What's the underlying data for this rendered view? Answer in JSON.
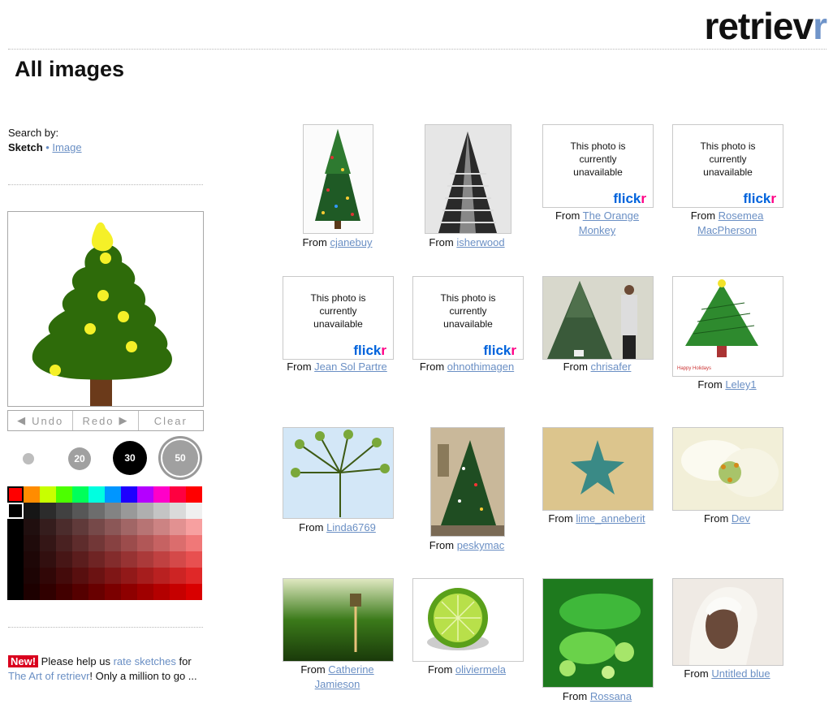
{
  "logo": {
    "part1": "retriev",
    "part2": "r"
  },
  "page_title": "All images",
  "search": {
    "label": "Search by:",
    "sketch": "Sketch",
    "sep": " • ",
    "image": "Image"
  },
  "controls": {
    "undo": "Undo",
    "redo": "Redo",
    "clear": "Clear"
  },
  "brushes": [
    "",
    "20",
    "30",
    "50"
  ],
  "unavailable_text": [
    "This photo is",
    "currently",
    "unavailable"
  ],
  "flickr": {
    "a": "flick",
    "b": "r"
  },
  "results": [
    {
      "from": "From",
      "user": "cjanebuy"
    },
    {
      "from": "From",
      "user": "isherwood"
    },
    {
      "from": "From",
      "user": "The Orange Monkey"
    },
    {
      "from": "From",
      "user": "Rosemea MacPherson"
    },
    {
      "from": "From",
      "user": "Jean Sol Partre"
    },
    {
      "from": "From",
      "user": "ohnothimagen"
    },
    {
      "from": "From",
      "user": "chrisafer"
    },
    {
      "from": "From",
      "user": "Leley1"
    },
    {
      "from": "From",
      "user": "Linda6769"
    },
    {
      "from": "From",
      "user": "peskymac"
    },
    {
      "from": "From",
      "user": "lime_anneberit"
    },
    {
      "from": "From",
      "user": "Dev"
    },
    {
      "from": "From",
      "user": "Catherine Jamieson"
    },
    {
      "from": "From",
      "user": "oliviermela"
    },
    {
      "from": "From",
      "user": "Rossana"
    },
    {
      "from": "From",
      "user": "Untitled blue"
    }
  ],
  "news": {
    "badge": "New!",
    "t1": " Please help us ",
    "link1": "rate sketches",
    "t2": " for ",
    "link2": "The Art of retrievr",
    "t3": "! Only a million to go ..."
  },
  "colors": {
    "accent": "#6a8fc4",
    "new_badge": "#d9001e",
    "flickr_blue": "#0063dc",
    "flickr_pink": "#ff0084"
  }
}
